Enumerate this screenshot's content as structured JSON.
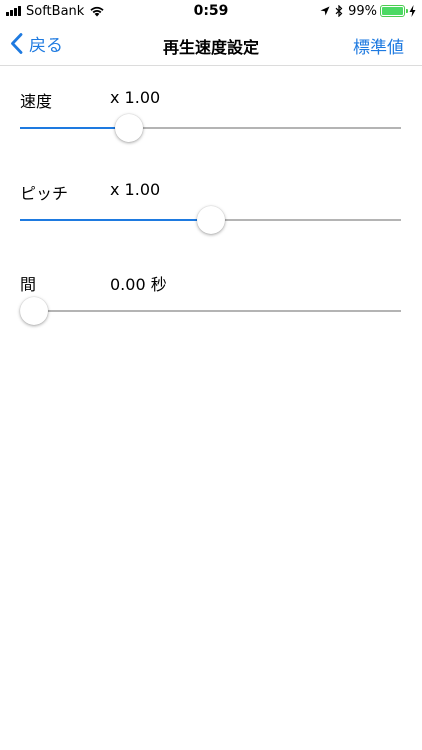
{
  "status_bar": {
    "carrier": "SoftBank",
    "time": "0:59",
    "battery_percent": "99%",
    "battery_level": 0.99,
    "icons": [
      "signal-bars-icon",
      "wifi-icon",
      "location-arrow-icon",
      "bluetooth-icon",
      "battery-icon",
      "charging-bolt-icon"
    ]
  },
  "nav": {
    "back_label": "戻る",
    "title": "再生速度設定",
    "reset_label": "標準値"
  },
  "settings": [
    {
      "label": "速度",
      "value": "x 1.00",
      "slider_fraction": 0.27
    },
    {
      "label": "ピッチ",
      "value": "x 1.00",
      "slider_fraction": 0.5
    },
    {
      "label": "間",
      "value": "0.00 秒",
      "slider_fraction": 0.0
    }
  ],
  "colors": {
    "accent": "#1e7ae0",
    "track": "#b4b4b4",
    "battery": "#4cd964"
  }
}
